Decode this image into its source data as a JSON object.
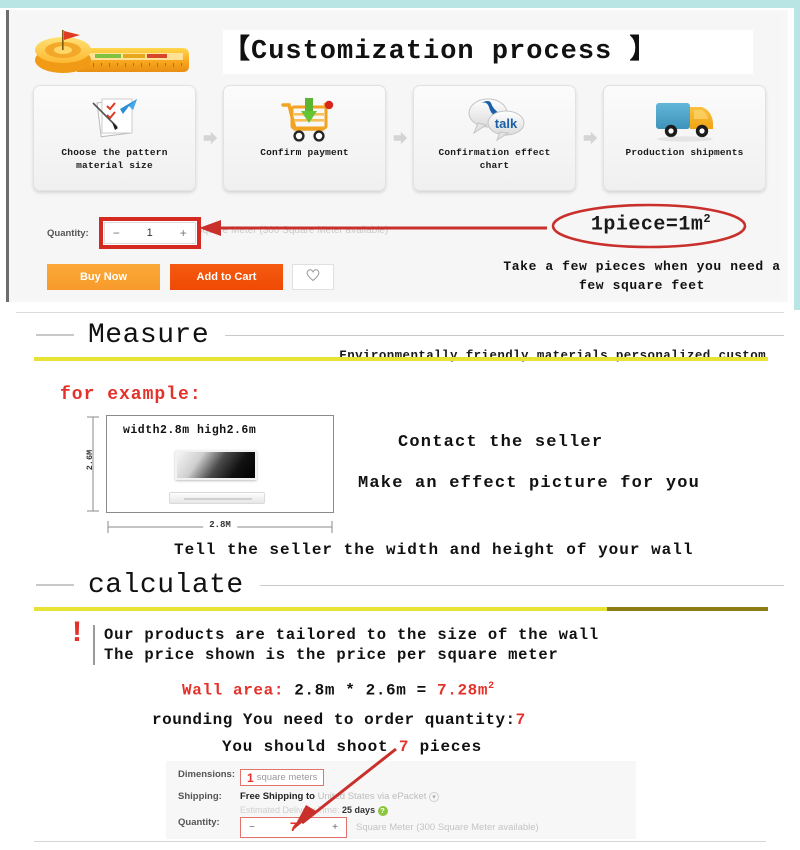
{
  "theme": {
    "teal": "#b9e5e4",
    "red": "#e4322b",
    "red_box": "#d42a22",
    "yellow": "#e8e235",
    "olive": "#8d7d12",
    "buy_now_orange": "#fba939",
    "add_cart_orange": "#f55a10",
    "panel_bg": "#f6f6f6"
  },
  "process": {
    "title": "【Customization process 】",
    "tape_icon": "measuring-tape-icon",
    "steps": [
      {
        "label": "Choose the pattern\nmaterial size",
        "icon": "pattern-document-icon"
      },
      {
        "label": "Confirm payment",
        "icon": "shopping-cart-download-icon"
      },
      {
        "label": "Confirmation effect\nchart",
        "icon": "chat-talk-bubble-icon",
        "icon_text": "talk"
      },
      {
        "label": "Production shipments",
        "icon": "delivery-truck-icon"
      }
    ],
    "arrow_icon": "right-arrow-icon",
    "quantity": {
      "label": "Quantity:",
      "minus": "−",
      "value": "1",
      "plus": "+",
      "stock_note": "Square Meter (300 Square Meter available)"
    },
    "buttons": {
      "buy_now": "Buy Now",
      "add_to_cart": "Add to Cart",
      "wishlist_icon": "heart-icon"
    },
    "callout": {
      "text": "1piece=1m",
      "sup": "2",
      "note": "Take a few pieces when\nyou need a few square feet"
    }
  },
  "measure": {
    "heading": "Measure",
    "tagline": "Environmentally friendly materials personalized custom",
    "for_example": "for example:",
    "diagram": {
      "caption": "width2.8m  high2.6m",
      "height_label": "2.6M",
      "width_label": "2.8M",
      "tv_icon": "television-icon",
      "stand_icon": "tv-stand-icon"
    },
    "contact_seller": "Contact the seller",
    "make_effect": "Make an effect picture for you",
    "tell_seller": "Tell the seller the width and height of your wall"
  },
  "calculate": {
    "heading": "calculate",
    "warning_icon": "exclamation-icon",
    "warning_line1": "Our products are tailored to the size of the wall",
    "warning_line2": "The price shown is the price per square meter",
    "wall_area_label": "Wall area:",
    "wall_area_expr": "2.8m * 2.6m =",
    "wall_area_result": "7.28m",
    "wall_area_sup": "2",
    "rounding_text": "rounding  You need to order quantity:",
    "rounding_qty": "7",
    "shoot_prefix": "You should shoot ",
    "shoot_qty": "7",
    "shoot_suffix": " pieces",
    "form": {
      "dimensions_label": "Dimensions:",
      "dimensions_value": "1",
      "dimensions_unit": "square meters",
      "shipping_label": "Shipping:",
      "shipping_bold": "Free Shipping to",
      "shipping_rest": "United States via ePacket",
      "shipping_chevron_icon": "chevron-down-icon",
      "delivery_label": "Estimated Delivery Time:",
      "delivery_value": "25 days",
      "delivery_help_icon": "question-mark-icon",
      "quantity_label": "Quantity:",
      "qty_minus": "−",
      "qty_value": "7",
      "qty_plus": "+",
      "qty_note": "Square Meter (300 Square Meter available)"
    }
  }
}
